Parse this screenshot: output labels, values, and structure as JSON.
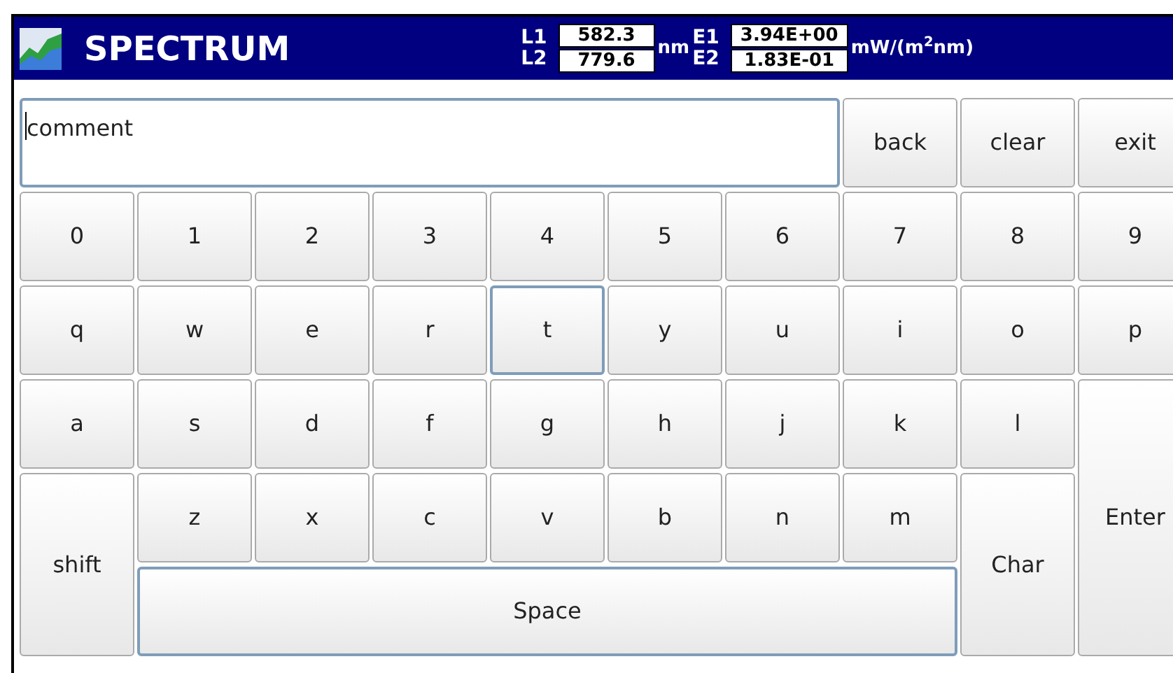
{
  "title_bar": {
    "title": "SPECTRUM",
    "readouts": [
      {
        "label_1": "L1",
        "label_2": "L2",
        "value_1": "582.3",
        "value_2": "779.6",
        "unit": "nm"
      },
      {
        "label_1": "E1",
        "label_2": "E2",
        "value_1": "3.94E+00",
        "value_2": "1.83E-01",
        "unit": "mW/(m$^{2}$nm)"
      }
    ]
  },
  "input": {
    "value": "comment"
  },
  "keys": [
    {
      "label": "back",
      "kind": "key",
      "highlighted": false
    },
    {
      "label": "clear",
      "kind": "key",
      "highlighted": false
    },
    {
      "label": "exit",
      "kind": "key",
      "highlighted": false
    },
    {
      "label": "0",
      "kind": "key",
      "highlighted": false
    },
    {
      "label": "1",
      "kind": "key",
      "highlighted": false
    },
    {
      "label": "2",
      "kind": "key",
      "highlighted": false
    },
    {
      "label": "3",
      "kind": "key",
      "highlighted": false
    },
    {
      "label": "4",
      "kind": "key",
      "highlighted": false
    },
    {
      "label": "5",
      "kind": "key",
      "highlighted": false
    },
    {
      "label": "6",
      "kind": "key",
      "highlighted": false
    },
    {
      "label": "7",
      "kind": "key",
      "highlighted": false
    },
    {
      "label": "8",
      "kind": "key",
      "highlighted": false
    },
    {
      "label": "9",
      "kind": "key",
      "highlighted": false
    },
    {
      "label": "q",
      "kind": "key",
      "highlighted": false
    },
    {
      "label": "w",
      "kind": "key",
      "highlighted": false
    },
    {
      "label": "e",
      "kind": "key",
      "highlighted": false
    },
    {
      "label": "r",
      "kind": "key",
      "highlighted": false
    },
    {
      "label": "t",
      "kind": "key",
      "highlighted": true
    },
    {
      "label": "y",
      "kind": "key",
      "highlighted": false
    },
    {
      "label": "u",
      "kind": "key",
      "highlighted": false
    },
    {
      "label": "i",
      "kind": "key",
      "highlighted": false
    },
    {
      "label": "o",
      "kind": "key",
      "highlighted": false
    },
    {
      "label": "p",
      "kind": "key",
      "highlighted": false
    },
    {
      "label": "a",
      "kind": "key",
      "highlighted": false
    },
    {
      "label": "s",
      "kind": "key",
      "highlighted": false
    },
    {
      "label": "d",
      "kind": "key",
      "highlighted": false
    },
    {
      "label": "f",
      "kind": "key",
      "highlighted": false
    },
    {
      "label": "g",
      "kind": "key",
      "highlighted": false
    },
    {
      "label": "h",
      "kind": "key",
      "highlighted": false
    },
    {
      "label": "j",
      "kind": "key",
      "highlighted": false
    },
    {
      "label": "k",
      "kind": "key",
      "highlighted": false
    },
    {
      "label": "l",
      "kind": "key",
      "highlighted": false
    },
    {
      "label": "Enter",
      "kind": "tall3",
      "highlighted": false
    },
    {
      "label": "shift",
      "kind": "tall2",
      "highlighted": false
    },
    {
      "label": "z",
      "kind": "key",
      "highlighted": false
    },
    {
      "label": "x",
      "kind": "key",
      "highlighted": false
    },
    {
      "label": "c",
      "kind": "key",
      "highlighted": false
    },
    {
      "label": "v",
      "kind": "key",
      "highlighted": false
    },
    {
      "label": "b",
      "kind": "key",
      "highlighted": false
    },
    {
      "label": "n",
      "kind": "key",
      "highlighted": false
    },
    {
      "label": "m",
      "kind": "key",
      "highlighted": false
    },
    {
      "label": "Char",
      "kind": "tall2",
      "highlighted": false
    },
    {
      "label": "Space",
      "kind": "wide",
      "highlighted": true
    }
  ]
}
